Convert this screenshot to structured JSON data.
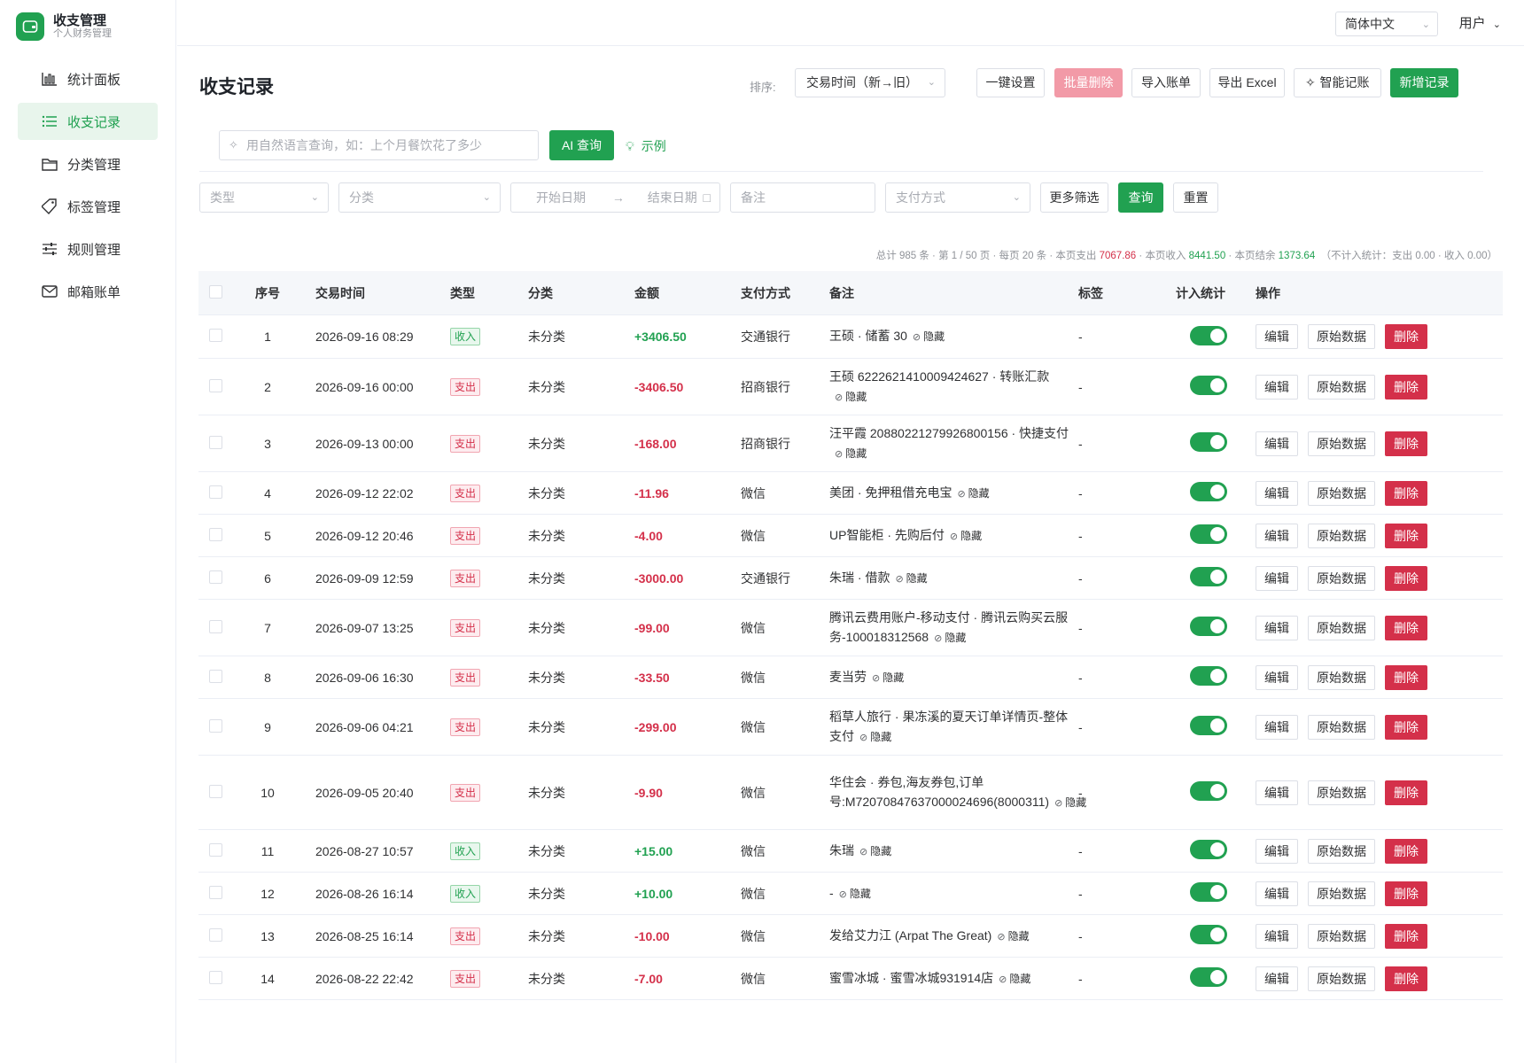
{
  "app": {
    "title": "收支管理",
    "subtitle": "个人财务管理"
  },
  "sidebar": {
    "items": [
      {
        "label": "统计面板",
        "icon": "bar-chart-icon",
        "active": false
      },
      {
        "label": "收支记录",
        "icon": "list-icon",
        "active": true
      },
      {
        "label": "分类管理",
        "icon": "folder-icon",
        "active": false
      },
      {
        "label": "标签管理",
        "icon": "tag-icon",
        "active": false
      },
      {
        "label": "规则管理",
        "icon": "sliders-icon",
        "active": false
      },
      {
        "label": "邮箱账单",
        "icon": "mail-icon",
        "active": false
      }
    ]
  },
  "topbar": {
    "language": "简体中文",
    "user": "用户"
  },
  "page": {
    "title": "收支记录",
    "sort_label": "排序:",
    "sort_value": "交易时间（新→旧）",
    "buttons": {
      "one_click": "一键设置",
      "batch_delete": "批量删除",
      "import": "导入账单",
      "export": "导出 Excel",
      "smart": "智能记账",
      "add": "新增记录"
    }
  },
  "search": {
    "placeholder": "用自然语言查询，如：上个月餐饮花了多少",
    "ai_button": "AI 查询",
    "example_link": "示例"
  },
  "filters": {
    "type_placeholder": "类型",
    "category_placeholder": "分类",
    "start_date": "开始日期",
    "end_date": "结束日期",
    "note_placeholder": "备注",
    "pay_placeholder": "支付方式",
    "more": "更多筛选",
    "query": "查询",
    "reset": "重置"
  },
  "summary": {
    "total": "总计 985 条",
    "page": "第 1 / 50 页",
    "per_page": "每页 20 条",
    "expense_label": "本页支出",
    "expense": "7067.86",
    "income_label": "本页收入",
    "income": "8441.50",
    "balance_label": "本页结余",
    "balance": "1373.64",
    "excluded": "（不计入统计：支出 0.00 · 收入 0.00）"
  },
  "table": {
    "headers": [
      "序号",
      "交易时间",
      "类型",
      "分类",
      "金额",
      "支付方式",
      "备注",
      "标签",
      "计入统计",
      "操作"
    ],
    "hide_label": "隐藏",
    "actions": {
      "edit": "编辑",
      "raw": "原始数据",
      "delete": "删除"
    },
    "rows": [
      {
        "idx": "1",
        "time": "2026-09-16 08:29",
        "type": "收入",
        "category": "未分类",
        "amount": "+3406.50",
        "pay": "交通银行",
        "note": "王硕 · 储蓄 30",
        "tag": "-"
      },
      {
        "idx": "2",
        "time": "2026-09-16 00:00",
        "type": "支出",
        "category": "未分类",
        "amount": "-3406.50",
        "pay": "招商银行",
        "note": "王硕 6222621410009424627 · 转账汇款",
        "tag": "-"
      },
      {
        "idx": "3",
        "time": "2026-09-13 00:00",
        "type": "支出",
        "category": "未分类",
        "amount": "-168.00",
        "pay": "招商银行",
        "note": "汪平霞 2088022127992680015​6 · 快捷支付",
        "tag": "-"
      },
      {
        "idx": "4",
        "time": "2026-09-12 22:02",
        "type": "支出",
        "category": "未分类",
        "amount": "-11.96",
        "pay": "微信",
        "note": "美团 · 免押租借充电宝",
        "tag": "-"
      },
      {
        "idx": "5",
        "time": "2026-09-12 20:46",
        "type": "支出",
        "category": "未分类",
        "amount": "-4.00",
        "pay": "微信",
        "note": "UP智能柜 · 先购后付",
        "tag": "-"
      },
      {
        "idx": "6",
        "time": "2026-09-09 12:59",
        "type": "支出",
        "category": "未分类",
        "amount": "-3000.00",
        "pay": "交通银行",
        "note": "朱瑞 · 借款",
        "tag": "-"
      },
      {
        "idx": "7",
        "time": "2026-09-07 13:25",
        "type": "支出",
        "category": "未分类",
        "amount": "-99.00",
        "pay": "微信",
        "note": "腾讯云费用账户-移动支付 · 腾讯云购买云服务-100018312568",
        "tag": "-"
      },
      {
        "idx": "8",
        "time": "2026-09-06 16:30",
        "type": "支出",
        "category": "未分类",
        "amount": "-33.50",
        "pay": "微信",
        "note": "麦当劳",
        "tag": "-"
      },
      {
        "idx": "9",
        "time": "2026-09-06 04:21",
        "type": "支出",
        "category": "未分类",
        "amount": "-299.00",
        "pay": "微信",
        "note": "稻草人旅行 · 果冻溪的夏天订单详情页-整体支付",
        "tag": "-"
      },
      {
        "idx": "10",
        "time": "2026-09-05 20:40",
        "type": "支出",
        "category": "未分类",
        "amount": "-9.90",
        "pay": "微信",
        "note": "华住会 · 券包,海友券包,订单号:M72070847637000024696(8000311)",
        "tag": "-"
      },
      {
        "idx": "11",
        "time": "2026-08-27 10:57",
        "type": "收入",
        "category": "未分类",
        "amount": "+15.00",
        "pay": "微信",
        "note": "朱瑞",
        "tag": "-"
      },
      {
        "idx": "12",
        "time": "2026-08-26 16:14",
        "type": "收入",
        "category": "未分类",
        "amount": "+10.00",
        "pay": "微信",
        "note": "-",
        "tag": "-"
      },
      {
        "idx": "13",
        "time": "2026-08-25 16:14",
        "type": "支出",
        "category": "未分类",
        "amount": "-10.00",
        "pay": "微信",
        "note": "发给艾力江 (Arpat The Great)",
        "tag": "-"
      },
      {
        "idx": "14",
        "time": "2026-08-22 22:42",
        "type": "支出",
        "category": "未分类",
        "amount": "-7.00",
        "pay": "微信",
        "note": "蜜雪冰城 · 蜜雪冰城931914店",
        "tag": "-"
      }
    ]
  },
  "colors": {
    "accent": "#21a151",
    "danger": "#d4304a",
    "danger_light": "#f29aa7"
  }
}
